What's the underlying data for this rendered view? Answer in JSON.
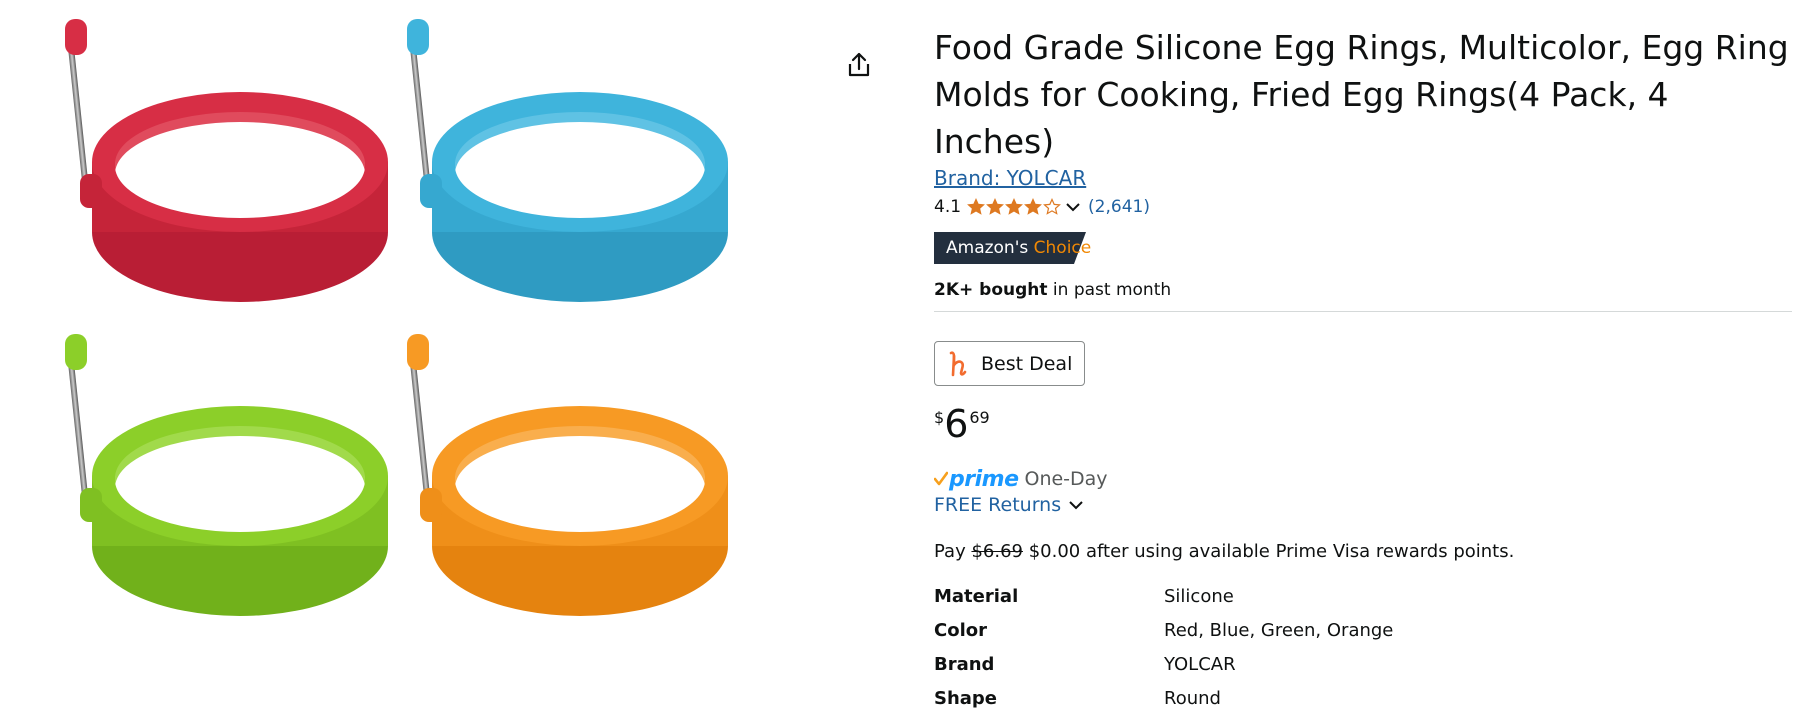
{
  "product": {
    "title": "Food Grade Silicone Egg Rings, Multicolor, Egg Ring Molds for Cooking, Fried Egg Rings(4 Pack, 4 Inches)",
    "brand_link": "Brand: YOLCAR",
    "rating": "4.1",
    "rating_stars": 4.1,
    "review_count": "(2,641)",
    "badge": {
      "prefix": "Amazon's",
      "accent": "Choice"
    },
    "bought": {
      "bold": "2K+ bought",
      "rest": " in past month"
    },
    "deal_label": "Best Deal",
    "price": {
      "symbol": "$",
      "whole": "6",
      "fraction": "69"
    },
    "prime": {
      "word": "prime",
      "speed": "One-Day"
    },
    "returns": "FREE Returns",
    "pay": {
      "prefix": "Pay ",
      "old": "$6.69",
      "rest": " $0.00 after using available Prime Visa rewards points."
    },
    "specs": [
      {
        "key": "Material",
        "value": "Silicone"
      },
      {
        "key": "Color",
        "value": "Red, Blue, Green, Orange"
      },
      {
        "key": "Brand",
        "value": "YOLCAR"
      },
      {
        "key": "Shape",
        "value": "Round"
      }
    ]
  },
  "image": {
    "rings": [
      {
        "name": "red",
        "color": "#d72e45"
      },
      {
        "name": "blue",
        "color": "#3fb4dc"
      },
      {
        "name": "green",
        "color": "#8ccf29"
      },
      {
        "name": "orange",
        "color": "#f79a24"
      }
    ]
  },
  "icons": {
    "share": "share-icon",
    "chevron": "chevron-down-icon",
    "deal": "honey-h-icon",
    "prime_check": "prime-check-icon"
  },
  "colors": {
    "link": "#2162a1",
    "star": "#de7921",
    "badge_bg": "#232f3e",
    "badge_accent": "#f08804",
    "prime_blue": "#1a98ff"
  }
}
